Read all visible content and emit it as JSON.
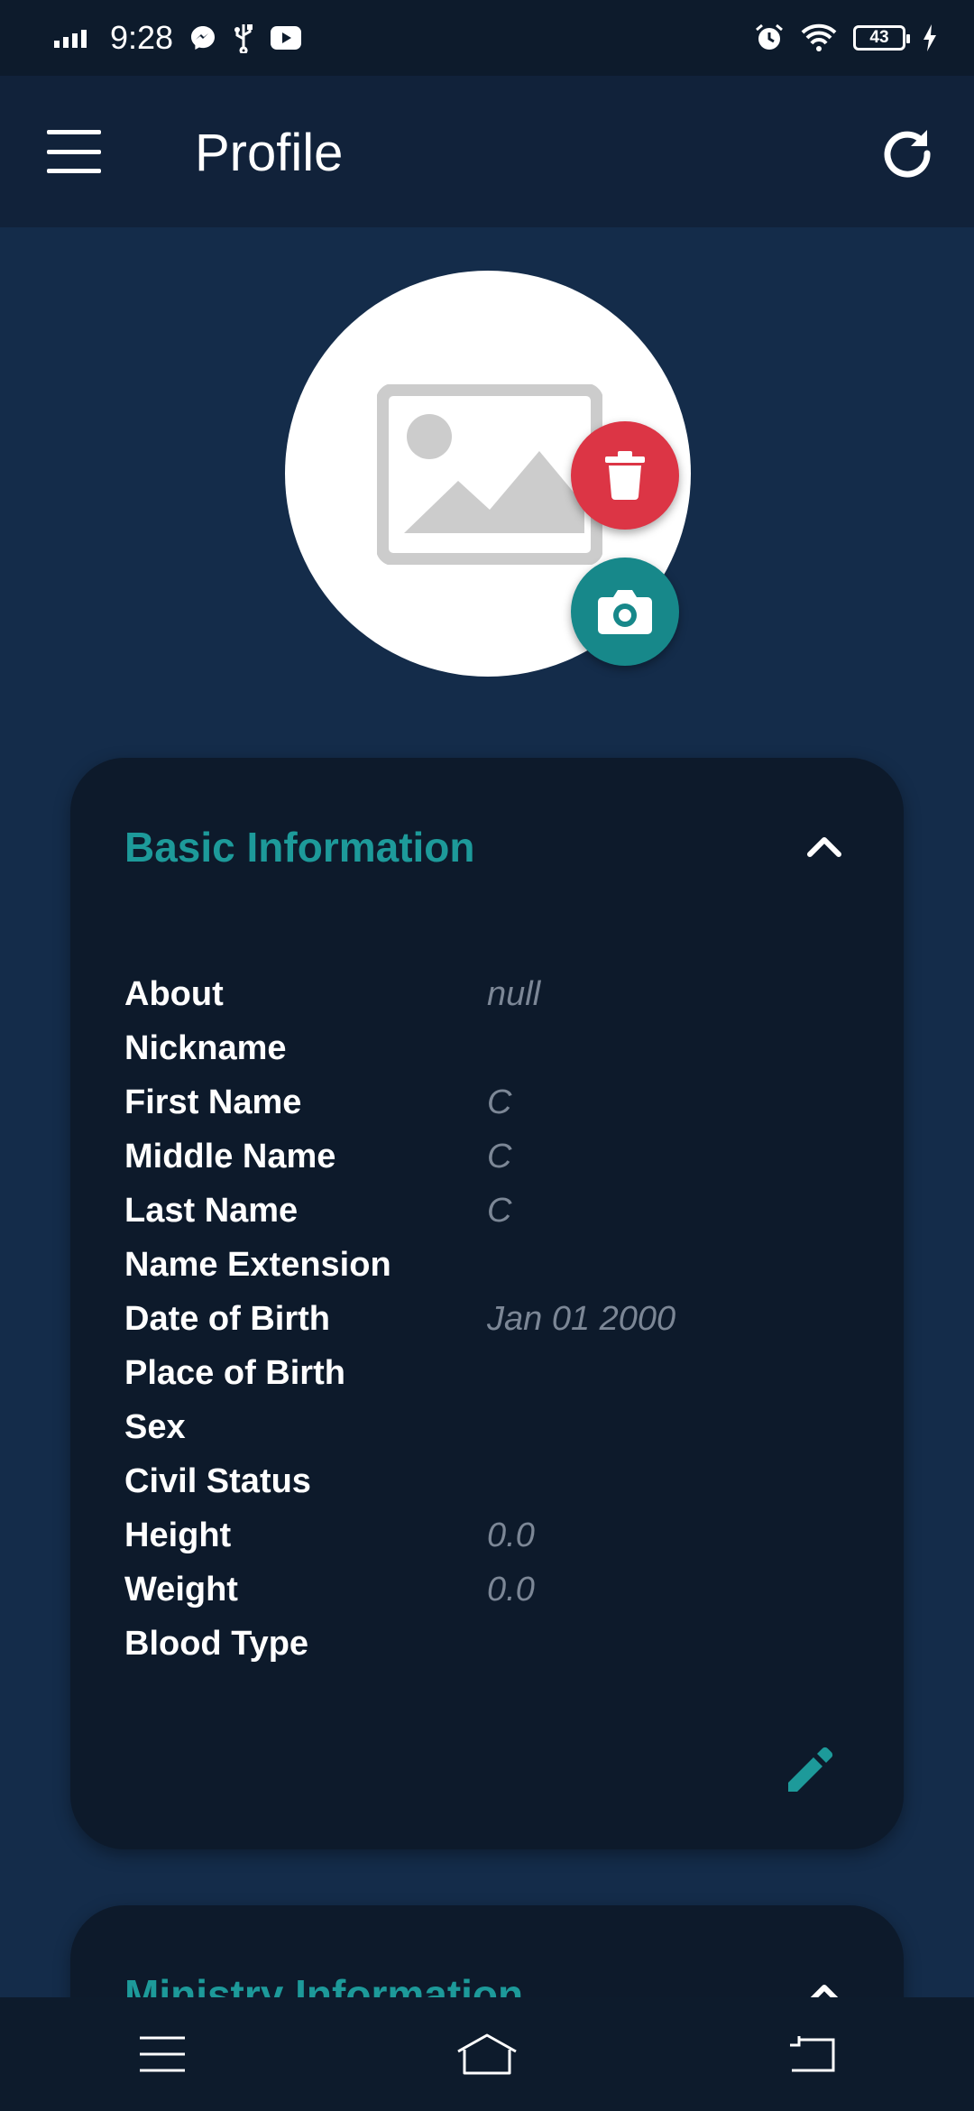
{
  "status_bar": {
    "time": "9:28",
    "left_icons": [
      "signal-icon",
      "messenger-icon",
      "usb-icon",
      "youtube-icon"
    ],
    "right_icons": [
      "alarm-icon",
      "wifi-icon",
      "battery-icon",
      "charging-icon"
    ],
    "battery_level": "43"
  },
  "app_bar": {
    "title": "Profile",
    "menu_icon": "menu-icon",
    "refresh_icon": "refresh-icon"
  },
  "avatar": {
    "placeholder_icon": "image-placeholder-icon",
    "delete_icon": "trash-icon",
    "camera_icon": "camera-icon"
  },
  "colors": {
    "background": "#142c4a",
    "card": "#0d1a2b",
    "accent": "#1d9a9a",
    "delete": "#dc3545",
    "camera": "#17888a",
    "value_text": "#7c8796"
  },
  "basic_info": {
    "title": "Basic Information",
    "rows": [
      {
        "label": "About",
        "value": "null"
      },
      {
        "label": "Nickname",
        "value": ""
      },
      {
        "label": "First Name",
        "value": "C"
      },
      {
        "label": "Middle Name",
        "value": "C"
      },
      {
        "label": "Last Name",
        "value": "C"
      },
      {
        "label": "Name Extension",
        "value": ""
      },
      {
        "label": "Date of Birth",
        "value": "Jan 01 2000"
      },
      {
        "label": "Place of Birth",
        "value": ""
      },
      {
        "label": "Sex",
        "value": ""
      },
      {
        "label": "Civil Status",
        "value": ""
      },
      {
        "label": "Height",
        "value": "0.0"
      },
      {
        "label": "Weight",
        "value": "0.0"
      },
      {
        "label": "Blood Type",
        "value": ""
      }
    ]
  },
  "ministry_info": {
    "title": "Ministry Information"
  },
  "nav_bar": {
    "icons": [
      "recents-icon",
      "home-icon",
      "back-icon"
    ]
  }
}
